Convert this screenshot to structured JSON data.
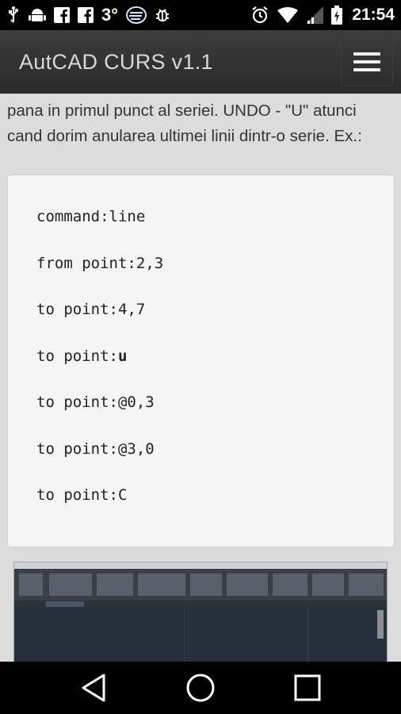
{
  "status_bar": {
    "left_icons": [
      "usb-icon",
      "android-debug-icon",
      "facebook-icon",
      "facebook-icon",
      "temperature-text",
      "weather-icon",
      "bug-icon"
    ],
    "temperature": "3°",
    "time": "21:54",
    "right_icons": [
      "alarm-icon",
      "wifi-icon",
      "signal-icon",
      "battery-icon"
    ]
  },
  "app_bar": {
    "title": "AutCAD CURS v1.1",
    "menu_icon": "hamburger-menu-icon"
  },
  "content": {
    "paragraph": "pana in primul punct al seriei. UNDO - \"U\" atunci cand dorim anularea ultimei linii dintr-o serie. Ex.:",
    "code_lines": [
      {
        "prefix": "command:",
        "value": "line"
      },
      {
        "prefix": "from point:",
        "value": "2,3"
      },
      {
        "prefix": "to point:",
        "value": "4,7"
      },
      {
        "prefix": "to point:",
        "value": "u"
      },
      {
        "prefix": "to point:",
        "value": "@0,3"
      },
      {
        "prefix": "to point:",
        "value": "@3,0"
      },
      {
        "prefix": "to point:",
        "value": "C"
      }
    ]
  },
  "nav_bar": {
    "back_icon": "back-triangle-icon",
    "home_icon": "home-circle-icon",
    "recents_icon": "recents-square-icon"
  },
  "colors": {
    "status_bar": "#000000",
    "app_bar": "#333333",
    "content_bg": "#dcdcdc",
    "code_bg": "#f5f5f5",
    "nav_bar": "#000000"
  }
}
